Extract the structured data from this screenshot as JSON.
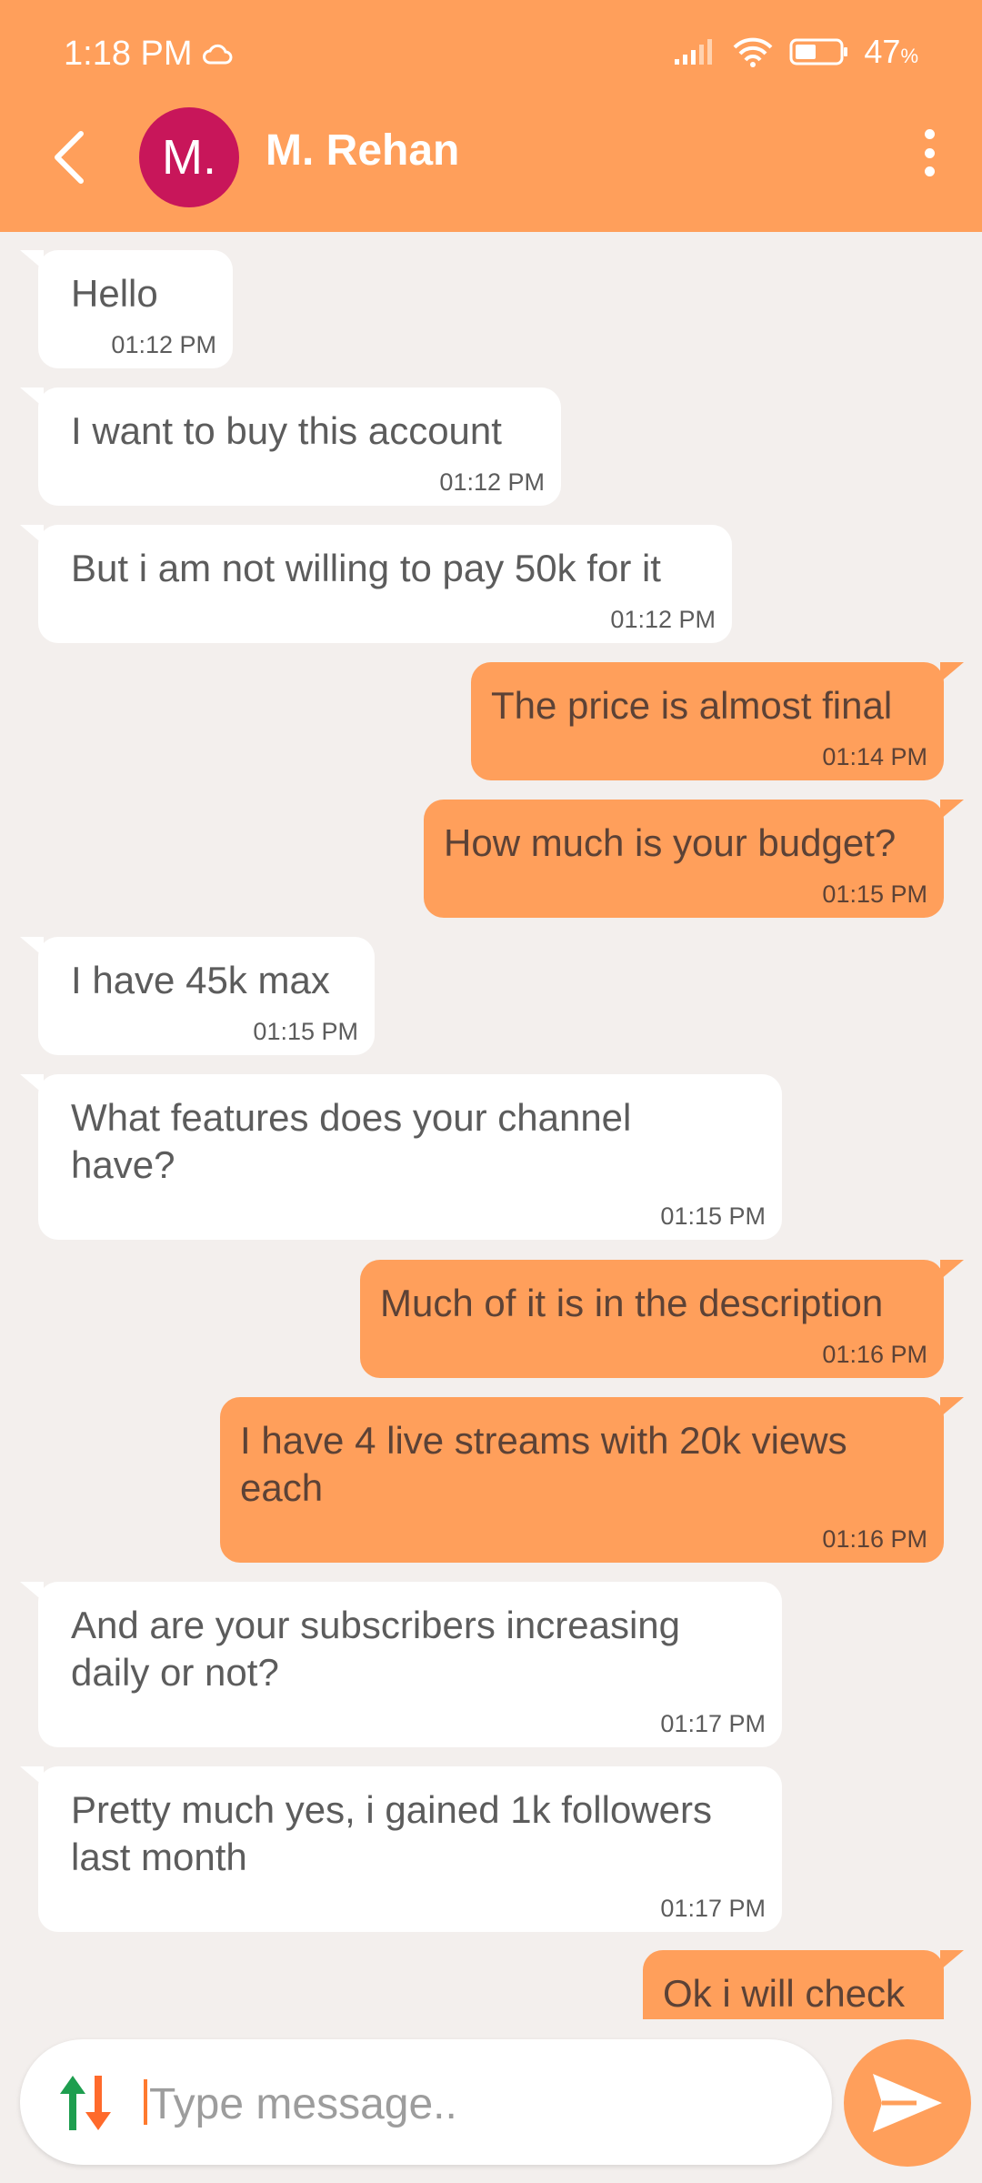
{
  "status_bar": {
    "time": "1:18 PM",
    "battery_percent": "47",
    "battery_suffix": "%"
  },
  "header": {
    "avatar_initial": "M.",
    "contact_name": "M. Rehan",
    "icons": [
      "back-arrow-icon",
      "more-vert-icon"
    ]
  },
  "messages": [
    {
      "dir": "in",
      "text": "Hello",
      "time": "01:12 PM"
    },
    {
      "dir": "in",
      "text": "I want to buy this account",
      "time": "01:12 PM"
    },
    {
      "dir": "in",
      "text": "But i am not willing to pay 50k for it",
      "time": "01:12 PM"
    },
    {
      "dir": "out",
      "text": "The price is almost final",
      "time": "01:14 PM"
    },
    {
      "dir": "out",
      "text": "How much is your budget?",
      "time": "01:15 PM"
    },
    {
      "dir": "in",
      "text": "I have 45k max",
      "time": "01:15 PM"
    },
    {
      "dir": "in",
      "text": "What features does your channel have?",
      "time": "01:15 PM"
    },
    {
      "dir": "out",
      "text": "Much of it is in the description",
      "time": "01:16 PM"
    },
    {
      "dir": "out",
      "text": "I have 4 live streams with 20k views each",
      "time": "01:16 PM"
    },
    {
      "dir": "in",
      "text": "And are your subscribers increasing daily or not?",
      "time": "01:17 PM"
    },
    {
      "dir": "in",
      "text": "Pretty much yes, i gained 1k followers last month",
      "time": "01:17 PM"
    },
    {
      "dir": "out",
      "text": "Ok i will check",
      "time": ""
    }
  ],
  "composer": {
    "placeholder": "Type message..",
    "value": ""
  },
  "colors": {
    "accent": "#ff9f5b",
    "avatar": "#c8165a",
    "background": "#f3efed",
    "incoming_bubble": "#ffffff"
  }
}
